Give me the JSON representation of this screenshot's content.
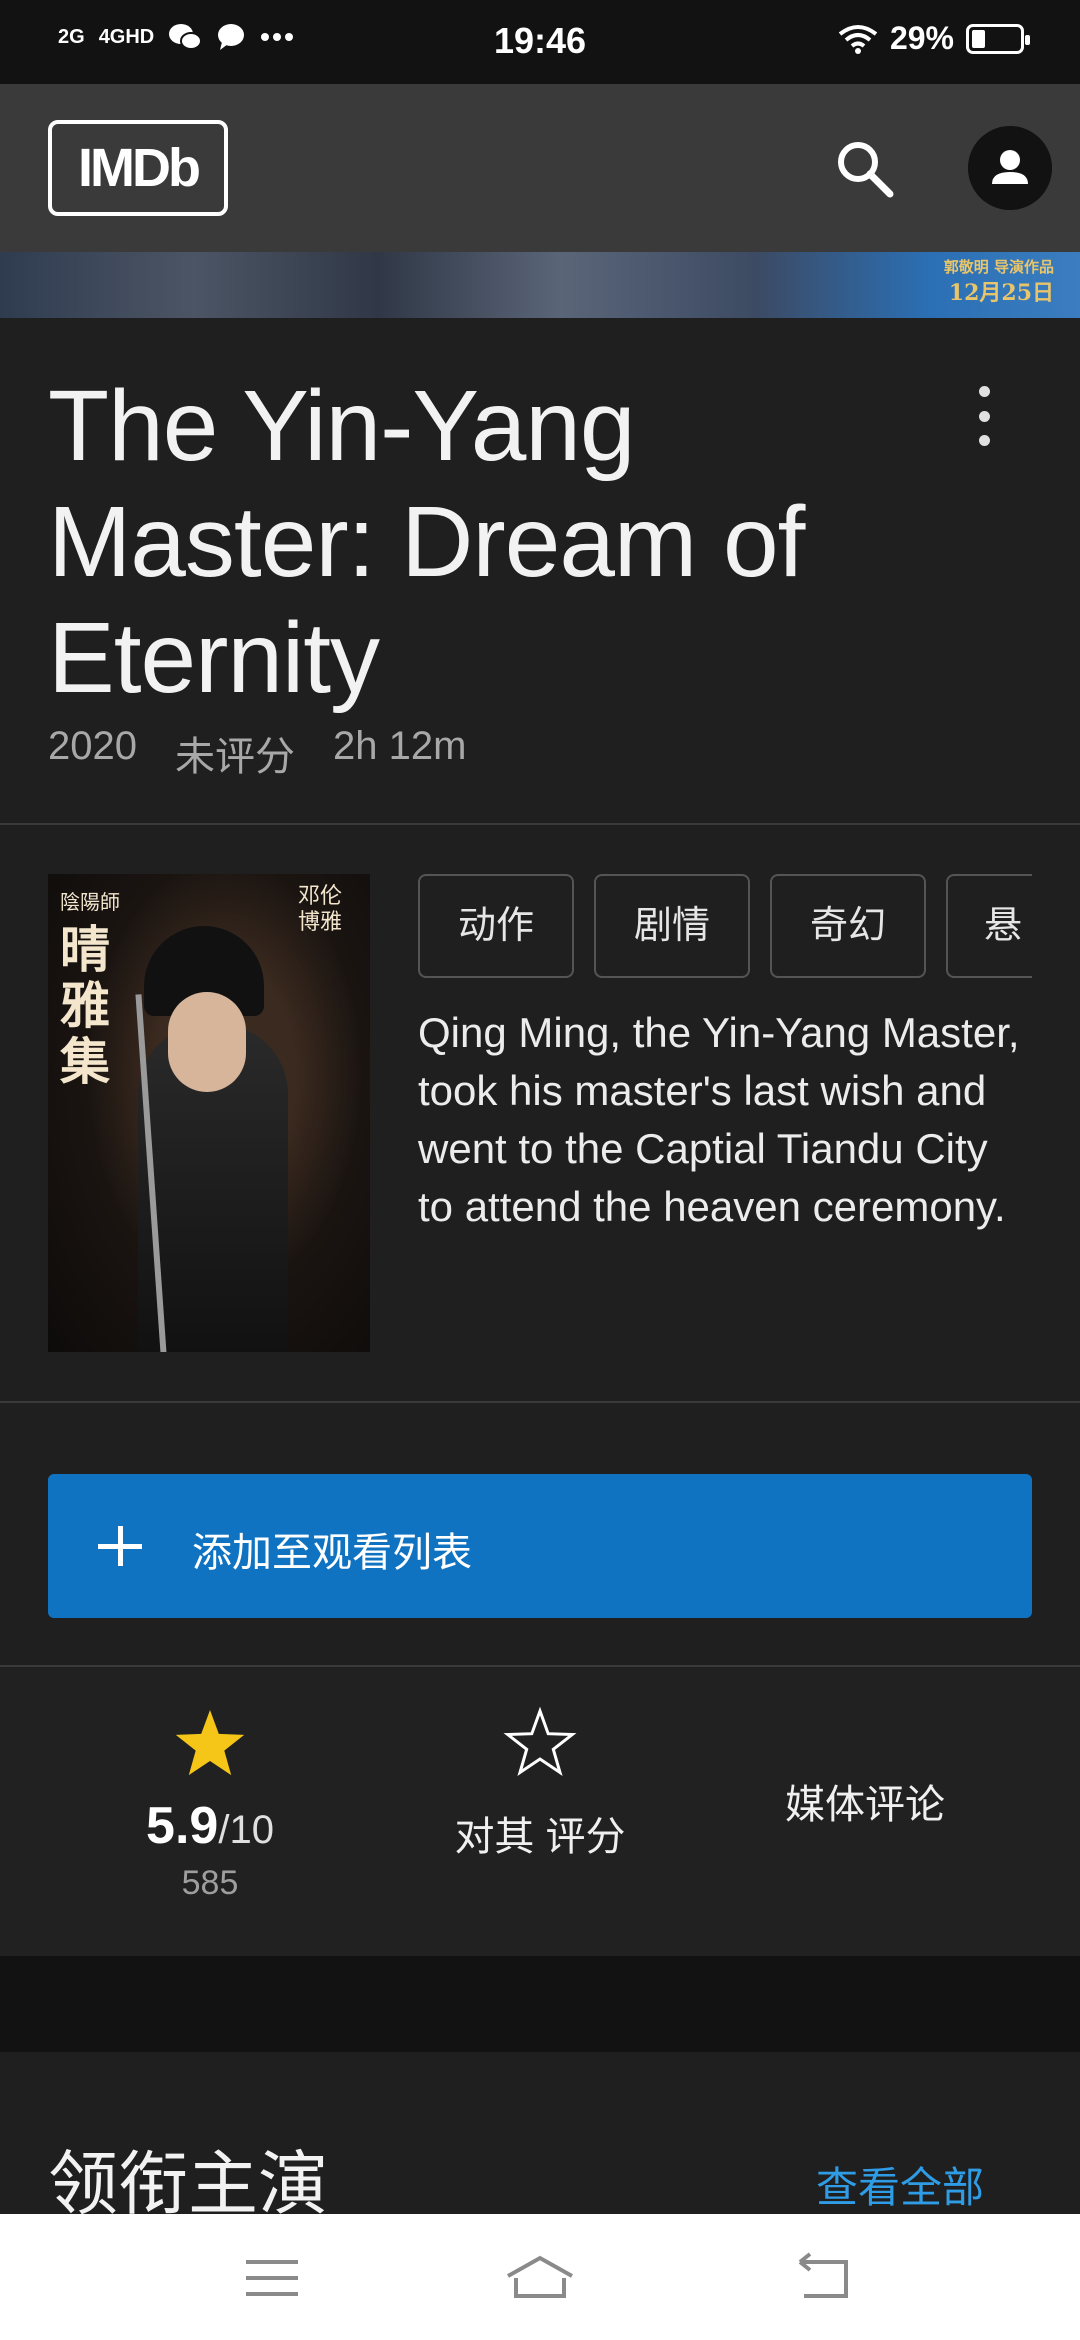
{
  "status_bar": {
    "signal_1": "2G",
    "signal_2": "4GHD",
    "time": "19:46",
    "battery_percent": "29%",
    "battery_level": 0.29
  },
  "header": {
    "logo": "IMDb",
    "search_icon": "search-icon",
    "account_icon": "account-icon"
  },
  "banner": {
    "line1": "郭敬明 导演作品",
    "line2": "12月25日"
  },
  "movie": {
    "title": "The Yin-Yang Master: Dream of Eternity",
    "year": "2020",
    "rating_status": "未评分",
    "runtime": "2h 12m",
    "genres": [
      "动作",
      "剧情",
      "奇幻",
      "悬"
    ],
    "plot": "Qing Ming, the Yin-Yang Master, took his master's last wish and went to the Captial Tiandu City to attend the heaven ceremony."
  },
  "poster": {
    "title_text": "晴雅集",
    "top_text": "陰陽師",
    "side_text": "邓伦 博雅"
  },
  "watchlist": {
    "label": "添加至观看列表"
  },
  "rating": {
    "score": "5.9",
    "scale": "/10",
    "votes": "585",
    "rate_label": "对其 评分",
    "media_review_label": "媒体评论"
  },
  "cast": {
    "title": "领衔主演",
    "see_all": "查看全部"
  },
  "colors": {
    "accent_blue": "#0f73c2",
    "star_gold": "#f5c518",
    "link_blue": "#2f9ce6"
  }
}
